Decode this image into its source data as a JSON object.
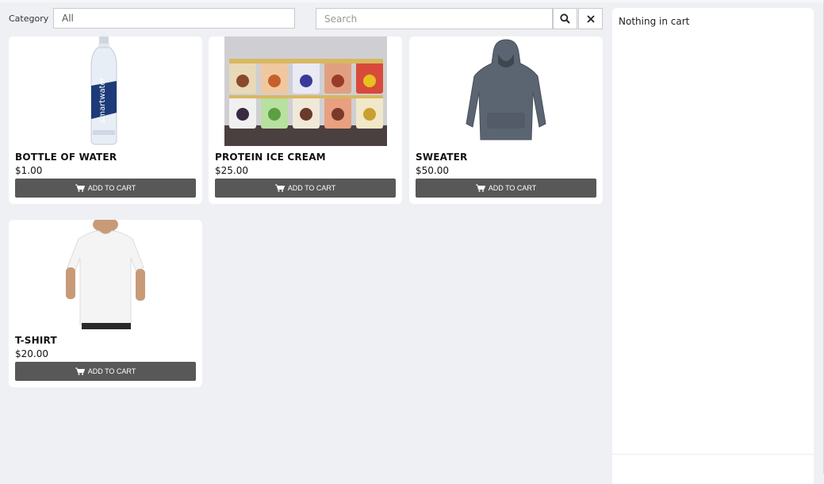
{
  "filters": {
    "category_label": "Category",
    "category_value": "All",
    "search_placeholder": "Search"
  },
  "products": [
    {
      "name": "BOTTLE OF WATER",
      "price": "$1.00",
      "button": "ADD TO CART",
      "image": "water-bottle"
    },
    {
      "name": "PROTEIN ICE CREAM",
      "price": "$25.00",
      "button": "ADD TO CART",
      "image": "ice-cream-pints"
    },
    {
      "name": "SWEATER",
      "price": "$50.00",
      "button": "ADD TO CART",
      "image": "hooded-sweater"
    },
    {
      "name": "T-SHIRT",
      "price": "$20.00",
      "button": "ADD TO CART",
      "image": "white-tshirt"
    }
  ],
  "cart": {
    "empty_text": "Nothing in cart"
  },
  "icons": {
    "search": "search-icon",
    "clear": "close-icon",
    "cart": "cart-icon"
  },
  "colors": {
    "page_bg": "#eff0f4",
    "button_bg": "#585858",
    "card_bg": "#ffffff"
  }
}
